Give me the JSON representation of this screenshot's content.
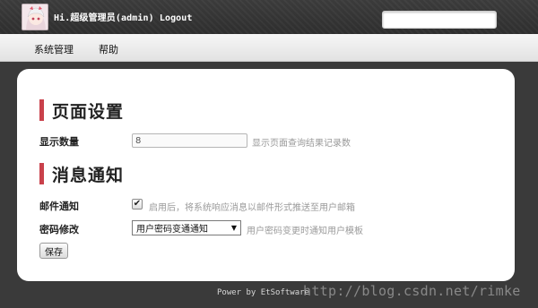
{
  "header": {
    "greeting": "Hi.超级管理员(admin) Logout",
    "search_placeholder": "",
    "avatar_icon": "anime-avatar-icon"
  },
  "menu": {
    "items": [
      {
        "label": "系统管理"
      },
      {
        "label": "帮助"
      }
    ]
  },
  "page_settings": {
    "title": "页面设置",
    "display_count": {
      "label": "显示数量",
      "value": "8",
      "hint": "显示页面查询结果记录数"
    }
  },
  "notifications": {
    "title": "消息通知",
    "email": {
      "label": "邮件通知",
      "checked": true,
      "hint": "启用后，将系统响应消息以邮件形式推送至用户邮箱"
    },
    "password_change": {
      "label": "密码修改",
      "selected": "用户密码变通通知",
      "hint": "用户密码变更时通知用户模板"
    }
  },
  "actions": {
    "save_label": "保存"
  },
  "footer": {
    "text": "Power by EtSoftware",
    "watermark": "http://blog.csdn.net/rimke"
  },
  "colors": {
    "accent": "#c9414b",
    "header_bg": "#333333",
    "page_bg": "#3a3a3a"
  }
}
